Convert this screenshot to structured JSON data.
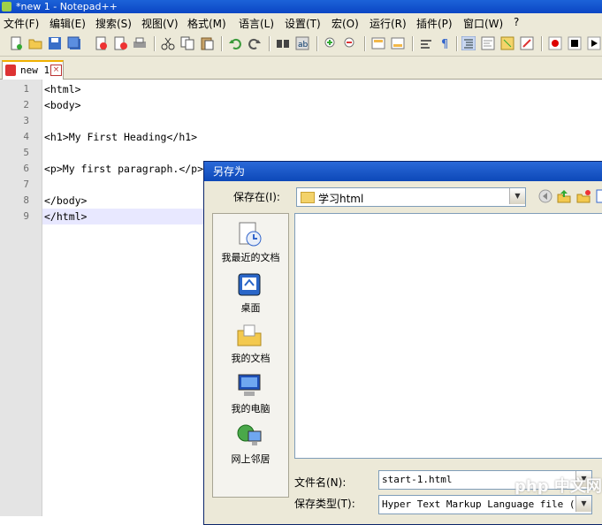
{
  "window": {
    "title": "*new 1 - Notepad++"
  },
  "menu": [
    "文件(F)",
    "编辑(E)",
    "搜索(S)",
    "视图(V)",
    "格式(M)",
    "语言(L)",
    "设置(T)",
    "宏(O)",
    "运行(R)",
    "插件(P)",
    "窗口(W)",
    "?"
  ],
  "tab": {
    "label": "new 1",
    "close": "×"
  },
  "editor": {
    "lines": [
      {
        "num": "1",
        "text": "<html>"
      },
      {
        "num": "2",
        "text": "<body>"
      },
      {
        "num": "3",
        "text": ""
      },
      {
        "num": "4",
        "text": "<h1>My First Heading</h1>"
      },
      {
        "num": "5",
        "text": ""
      },
      {
        "num": "6",
        "text": "<p>My first paragraph.</p>"
      },
      {
        "num": "7",
        "text": ""
      },
      {
        "num": "8",
        "text": "</body>"
      },
      {
        "num": "9",
        "text": "</html>"
      }
    ],
    "current_line": "9"
  },
  "dialog": {
    "title": "另存为",
    "save_in_label": "保存在(I):",
    "save_in_value": "学习html",
    "places": [
      "我最近的文档",
      "桌面",
      "我的文档",
      "我的电脑",
      "网上邻居"
    ],
    "filename_label": "文件名(N):",
    "filename_value": "start-1.html",
    "filetype_label": "保存类型(T):",
    "filetype_value": "Hyper Text Markup Language file (*.ht"
  },
  "watermark": "php 中文网",
  "colors": {
    "titlebar": "#0b46c4",
    "current_line": "#e8e8ff",
    "dialog_bg": "#ece9d8"
  }
}
